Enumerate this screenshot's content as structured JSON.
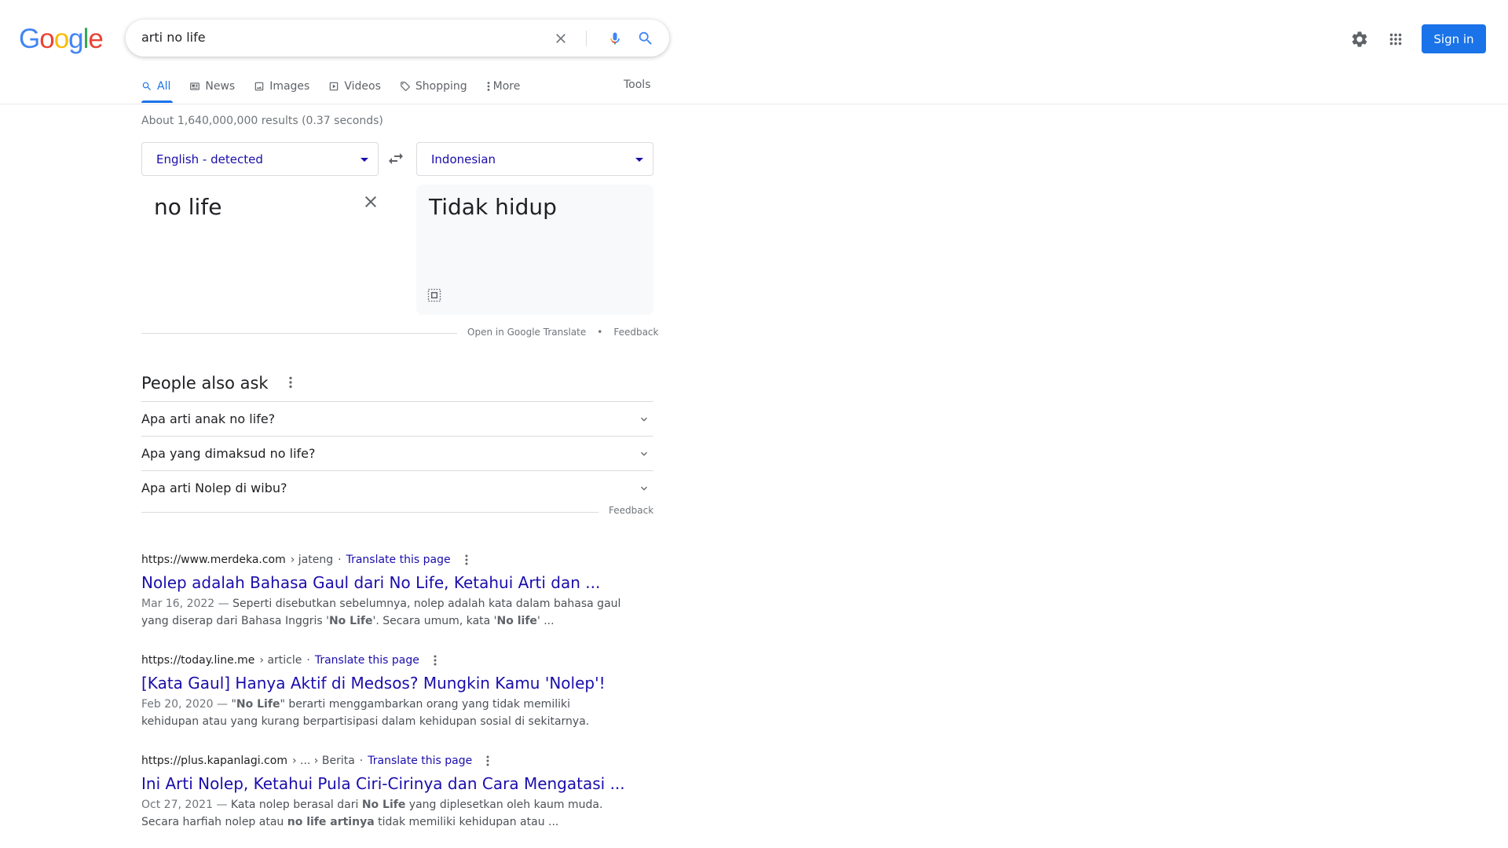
{
  "header": {
    "logo_letters": [
      "G",
      "o",
      "o",
      "g",
      "l",
      "e"
    ],
    "logo_colors": [
      "#4285f4",
      "#ea4335",
      "#fbbc05",
      "#4285f4",
      "#34a853",
      "#ea4335"
    ],
    "query": "arti no life",
    "signin_label": "Sign in"
  },
  "tabs": [
    {
      "label": "All",
      "icon": "search-icon",
      "active": true
    },
    {
      "label": "News",
      "icon": "news-icon"
    },
    {
      "label": "Images",
      "icon": "image-icon"
    },
    {
      "label": "Videos",
      "icon": "video-icon"
    },
    {
      "label": "Shopping",
      "icon": "tag-icon"
    },
    {
      "label": "More",
      "icon": "more-vert-icon"
    }
  ],
  "tools_label": "Tools",
  "stats": "About 1,640,000,000 results (0.37 seconds)",
  "translate": {
    "source_lang": "English - detected",
    "target_lang": "Indonesian",
    "source_text": "no life",
    "target_text": "Tidak hidup",
    "open_link": "Open in Google Translate",
    "separator": "•",
    "feedback": "Feedback"
  },
  "paa": {
    "title": "People also ask",
    "questions": [
      "Apa arti anak no life?",
      "Apa yang dimaksud no life?",
      "Apa arti Nolep di wibu?"
    ],
    "feedback": "Feedback"
  },
  "results": [
    {
      "domain": "https://www.merdeka.com",
      "path": "› jateng",
      "dot": "·",
      "translate": "Translate this page",
      "title": "Nolep adalah Bahasa Gaul dari No Life, Ketahui Arti dan ...",
      "date": "Mar 16, 2022 —",
      "snippet_html": " Seperti disebutkan sebelumnya, nolep adalah kata dalam bahasa gaul yang diserap dari Bahasa Inggris '<b>No Life</b>'. Secara umum, kata '<b>No life</b>' ..."
    },
    {
      "domain": "https://today.line.me",
      "path": "› article",
      "dot": "·",
      "translate": "Translate this page",
      "title": "[Kata Gaul] Hanya Aktif di Medsos? Mungkin Kamu 'Nolep'!",
      "date": "Feb 20, 2020 —",
      "snippet_html": " \"<b>No Life</b>\" berarti menggambarkan orang yang tidak memiliki kehidupan atau yang kurang berpartisipasi dalam kehidupan sosial di sekitarnya."
    },
    {
      "domain": "https://plus.kapanlagi.com",
      "path": "› ... › Berita",
      "dot": "·",
      "translate": "Translate this page",
      "title": "Ini Arti Nolep, Ketahui Pula Ciri-Cirinya dan Cara Mengatasi ...",
      "date": "Oct 27, 2021 —",
      "snippet_html": " Kata nolep berasal dari <b>No Life</b> yang diplesetkan oleh kaum muda. Secara harfiah nolep atau <b>no life artinya</b> tidak memiliki kehidupan atau ..."
    }
  ]
}
